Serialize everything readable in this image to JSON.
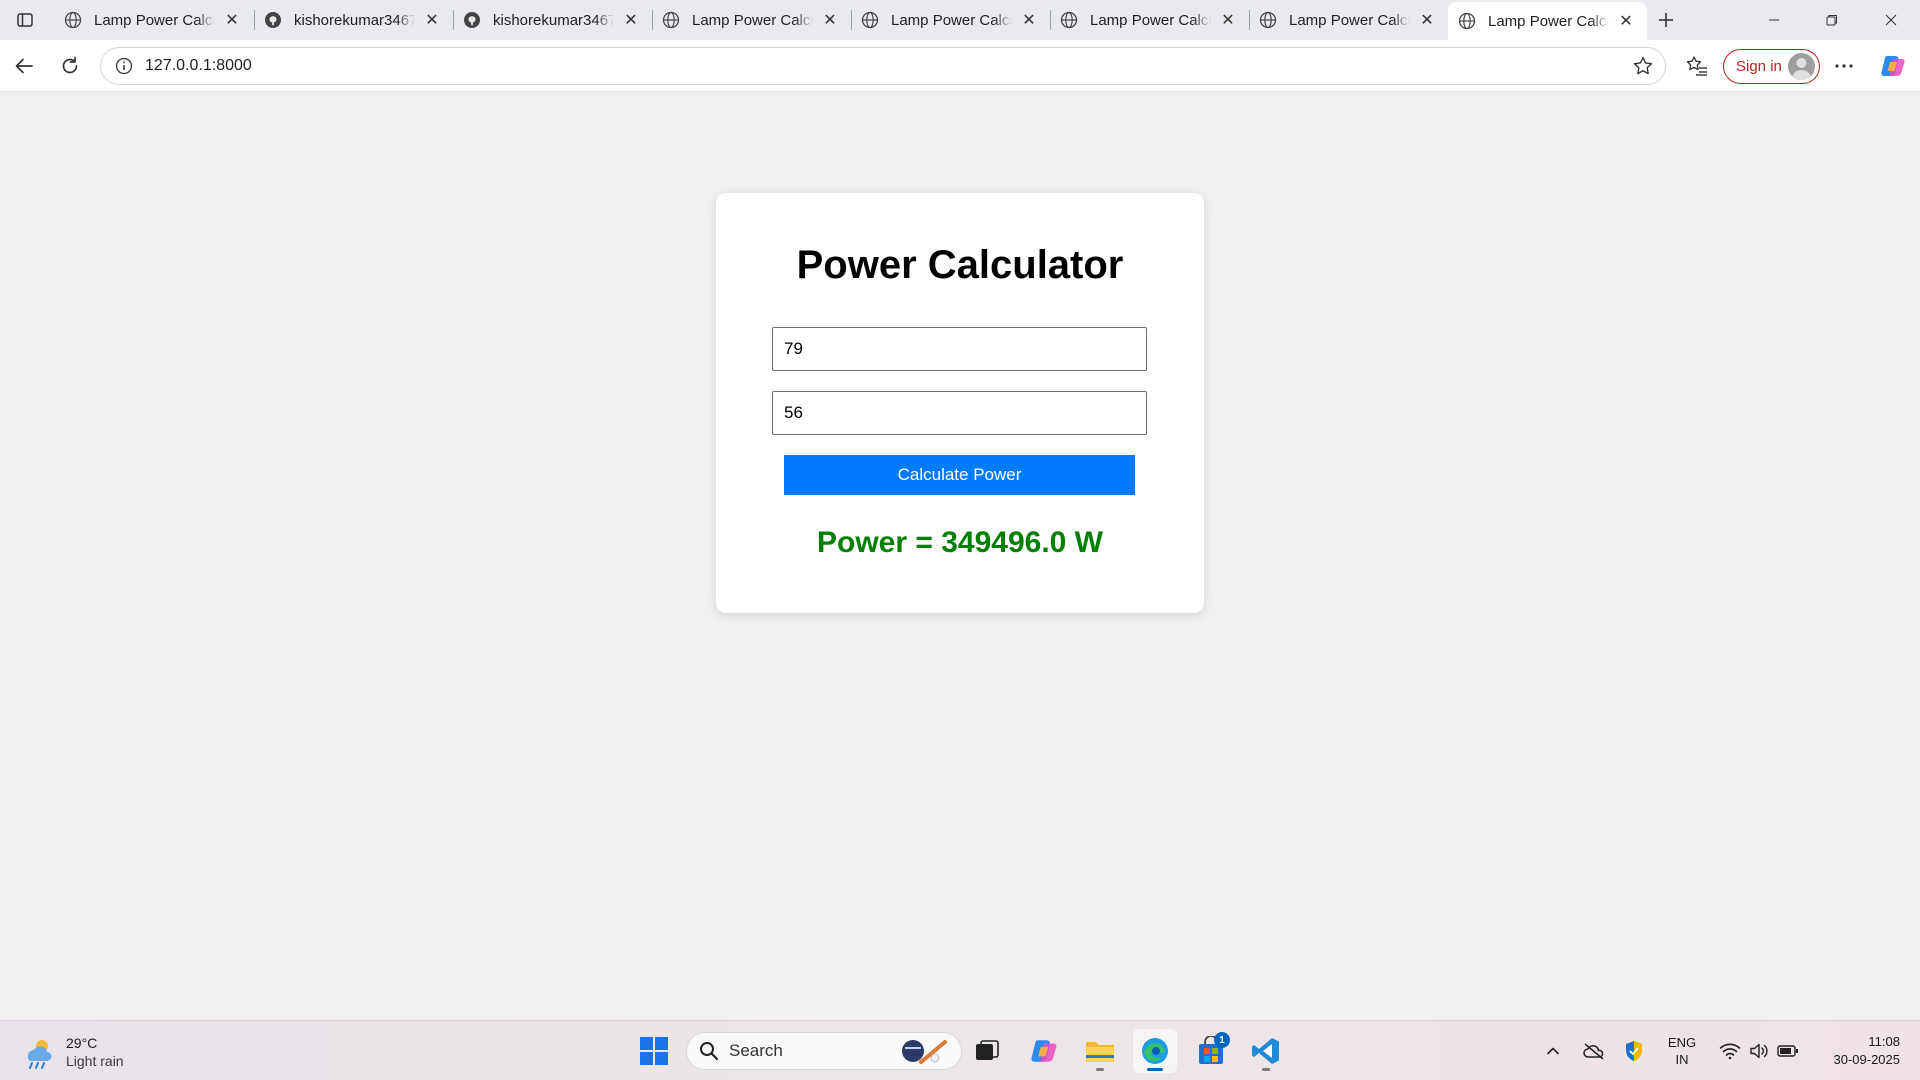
{
  "browser": {
    "tabs": [
      {
        "title": "Lamp Power Calcu",
        "favicon": "globe-icon",
        "active": false
      },
      {
        "title": "kishorekumar3467",
        "favicon": "github-icon",
        "active": false
      },
      {
        "title": "kishorekumar3467",
        "favicon": "github-icon",
        "active": false
      },
      {
        "title": "Lamp Power Calcu",
        "favicon": "globe-icon",
        "active": false
      },
      {
        "title": "Lamp Power Calcu",
        "favicon": "globe-icon",
        "active": false
      },
      {
        "title": "Lamp Power Calcu",
        "favicon": "globe-icon",
        "active": false
      },
      {
        "title": "Lamp Power Calcu",
        "favicon": "globe-icon",
        "active": false
      },
      {
        "title": "Lamp Power Calcu",
        "favicon": "globe-icon",
        "active": true
      }
    ],
    "address": "127.0.0.1:8000",
    "sign_in_label": "Sign in"
  },
  "page": {
    "title": "Power Calculator",
    "input1_value": "79",
    "input2_value": "56",
    "button_label": "Calculate Power",
    "result": "Power = 349496.0 W"
  },
  "taskbar": {
    "weather_temp": "29°C",
    "weather_cond": "Light rain",
    "search_label": "Search",
    "store_badge": "1",
    "lang_line1": "ENG",
    "lang_line2": "IN",
    "time": "11:08",
    "date": "30-09-2025"
  },
  "colors": {
    "button": "#007bff",
    "result": "#008000",
    "signin": "#b3261e"
  }
}
